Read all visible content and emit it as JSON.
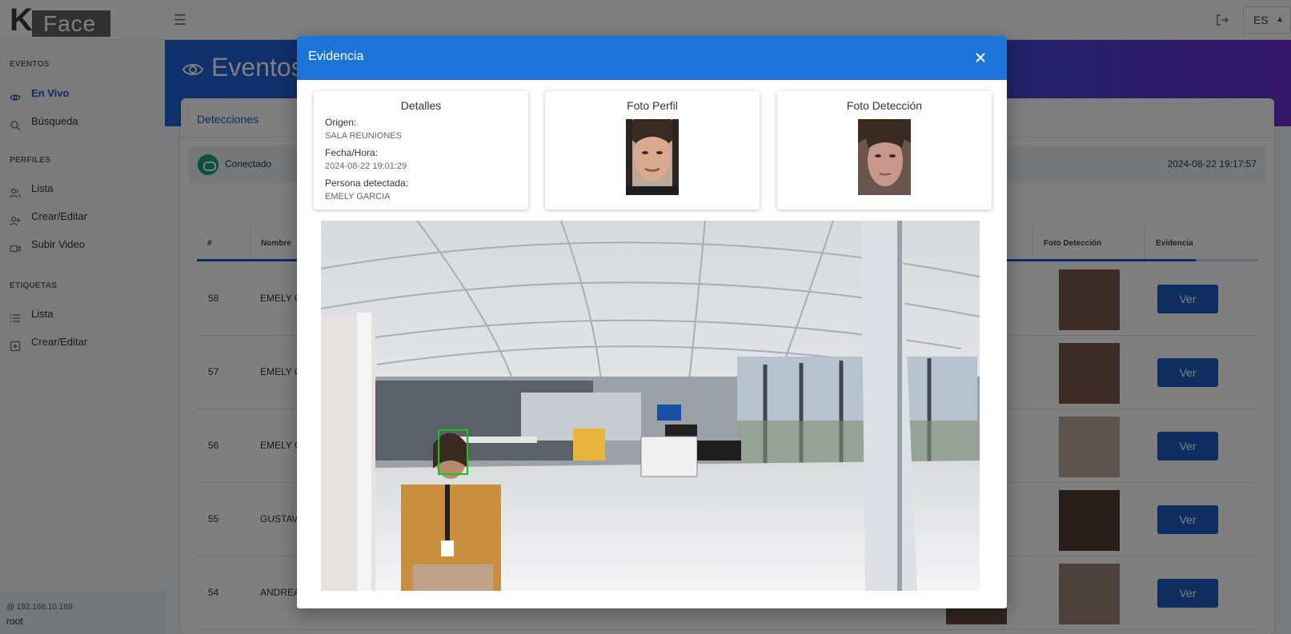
{
  "app": {
    "logo_k": "K",
    "logo_text": "Face",
    "lang": "ES"
  },
  "sidebar": {
    "sections": [
      {
        "title": "EVENTOS",
        "items": [
          "En Vivo",
          "Búsqueda"
        ]
      },
      {
        "title": "PERFILES",
        "items": [
          "Lista",
          "Crear/Editar",
          "Subir Video"
        ]
      },
      {
        "title": "ETIQUETAS",
        "items": [
          "Lista",
          "Crear/Editar"
        ]
      }
    ],
    "footer": {
      "ip": "@ 192.168.10.169",
      "user": "root"
    }
  },
  "page": {
    "title": "Eventos",
    "tab": "Detecciones",
    "status": "Conectado",
    "clock": "2024-08-22 19:17:57",
    "table": {
      "headers": [
        "#",
        "Nombre",
        "Foto Detección",
        "Evidencia"
      ],
      "rows": [
        {
          "num": "58",
          "name": "EMELY G"
        },
        {
          "num": "57",
          "name": "EMELY G"
        },
        {
          "num": "56",
          "name": "EMELY G"
        },
        {
          "num": "55",
          "name": "GUSTAV"
        },
        {
          "num": "54",
          "name": "ANDREA"
        }
      ],
      "action_label": "Ver"
    }
  },
  "modal": {
    "title": "Evidencia",
    "details": {
      "title": "Detalles",
      "origin_label": "Origen:",
      "origin_value": "SALA REUNIONES",
      "datetime_label": "Fecha/Hora:",
      "datetime_value": "2024-08-22 19:01:29",
      "person_label": "Persona detectada:",
      "person_value": "EMELY GARCIA"
    },
    "profile_photo_title": "Foto Perfil",
    "detection_photo_title": "Foto Detección"
  },
  "colors": {
    "primary": "#1e5bbd",
    "modal_header": "#1b75d8",
    "status_ok": "#1aa37a",
    "detection_box": "#19c219"
  }
}
